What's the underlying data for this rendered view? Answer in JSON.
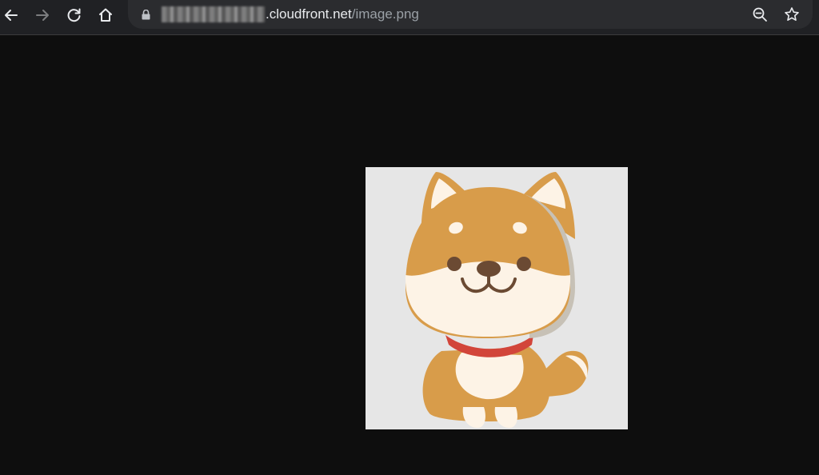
{
  "browser": {
    "nav": {
      "back_icon": "arrow-left-icon",
      "forward_icon": "arrow-right-icon",
      "reload_icon": "reload-icon",
      "home_icon": "home-icon"
    },
    "address_bar": {
      "redacted_host": "[pixelated]",
      "domain": ".cloudfront.net",
      "path": "/image.png",
      "lock_icon": "lock-icon",
      "zoom_icon": "zoom-out-icon",
      "bookmark_icon": "star-icon"
    }
  },
  "content": {
    "image": {
      "subject": "shiba-inu-dog-illustration",
      "background": "#e6e6e6"
    }
  },
  "colors": {
    "toolbar": "#202124",
    "omnibox": "#2b2c2f",
    "page_background": "#0e0e0e",
    "url_text": "#e8eaed",
    "url_path_text": "#9aa0a6"
  }
}
